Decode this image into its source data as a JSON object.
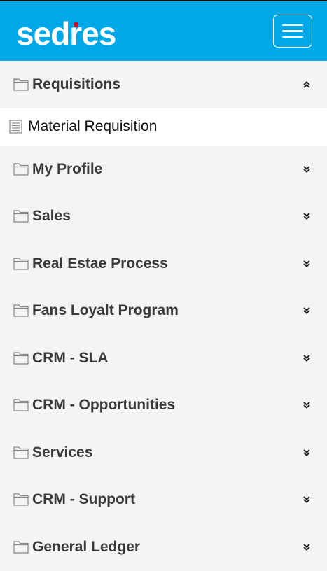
{
  "brand": {
    "logo_text_left": "sed",
    "logo_text_mark": "r",
    "logo_text_right": "es",
    "accent": "#00a8e8",
    "logo_dot": "#c8102e"
  },
  "header": {
    "menu_button_icon": "hamburger-icon"
  },
  "menu": {
    "expanded_section": {
      "label": "Requisitions",
      "icon": "folder-icon",
      "chevron": "chevron-up-icon",
      "items": [
        {
          "label": "Material Requisition",
          "icon": "document-list-icon"
        }
      ]
    },
    "sections": [
      {
        "label": "My Profile"
      },
      {
        "label": "Sales"
      },
      {
        "label": "Real Estae Process"
      },
      {
        "label": "Fans Loyalt Program"
      },
      {
        "label": "CRM - SLA"
      },
      {
        "label": "CRM - Opportunities"
      },
      {
        "label": "Services"
      },
      {
        "label": "CRM - Support"
      },
      {
        "label": "General Ledger"
      }
    ]
  }
}
